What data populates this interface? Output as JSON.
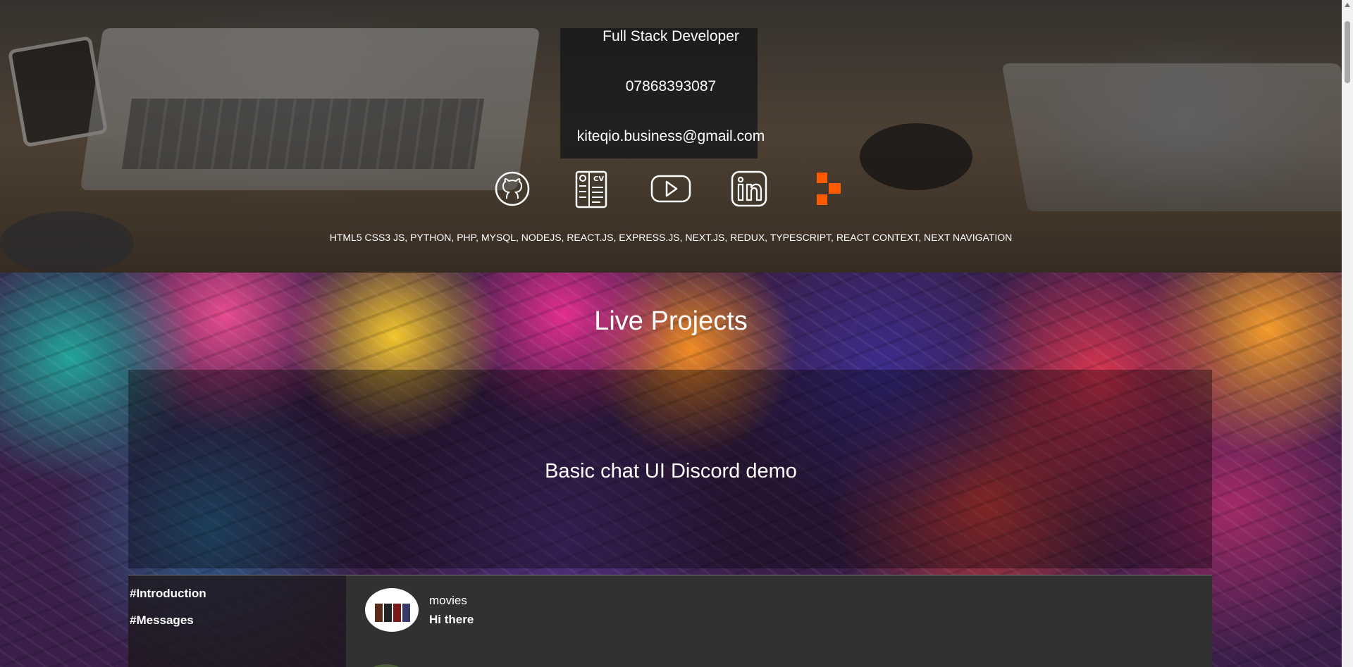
{
  "hero": {
    "role": "Full Stack Developer",
    "phone": "07868393087",
    "email": "kiteqio.business@gmail.com",
    "skills": "HTML5 CSS3 JS, PYTHON, PHP, MYSQL, NODEJS, REACT.JS, EXPRESS.JS, NEXT.JS, REDUX, TYPESCRIPT, REACT CONTEXT, NEXT NAVIGATION",
    "icons": [
      "github-icon",
      "cv-icon",
      "youtube-icon",
      "linkedin-icon",
      "portfolio-logo-icon"
    ],
    "accent_color": "#ff5a00"
  },
  "projects": {
    "title": "Live Projects",
    "card_title": "Basic chat UI Discord demo",
    "chat": {
      "channels": [
        "#Introduction",
        "#Messages"
      ],
      "message": {
        "user": "movies",
        "text": "Hi there"
      }
    }
  }
}
